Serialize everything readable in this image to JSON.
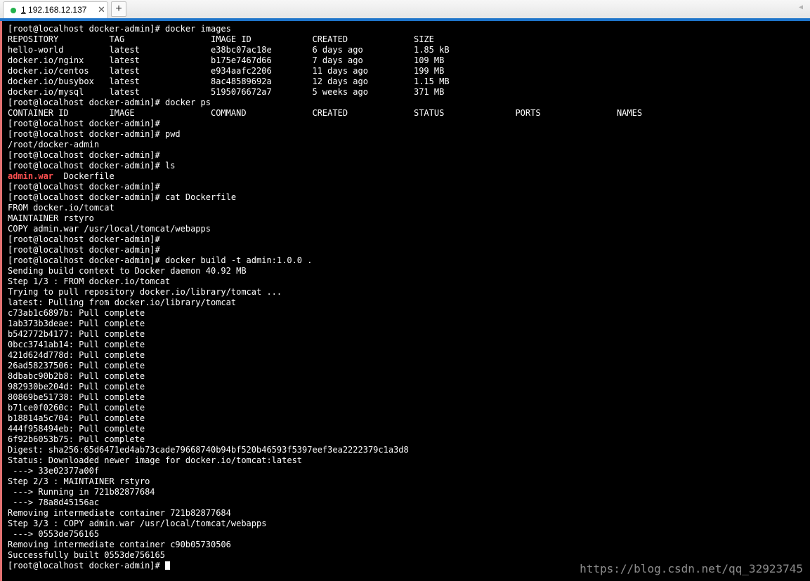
{
  "tab": {
    "number": "1",
    "title": "192.168.12.137",
    "close_glyph": "✕",
    "status_color": "#22b14c"
  },
  "toolbar": {
    "new_tab_glyph": "+",
    "scroll_left_glyph": "◀"
  },
  "terminal": {
    "lines": [
      "[root@localhost docker-admin]# docker images",
      "REPOSITORY          TAG                 IMAGE ID            CREATED             SIZE",
      "hello-world         latest              e38bc07ac18e        6 days ago          1.85 kB",
      "docker.io/nginx     latest              b175e7467d66        7 days ago          109 MB",
      "docker.io/centos    latest              e934aafc2206        11 days ago         199 MB",
      "docker.io/busybox   latest              8ac48589692a        12 days ago         1.15 MB",
      "docker.io/mysql     latest              5195076672a7        5 weeks ago         371 MB",
      "[root@localhost docker-admin]# docker ps",
      "CONTAINER ID        IMAGE               COMMAND             CREATED             STATUS              PORTS               NAMES",
      "[root@localhost docker-admin]#",
      "[root@localhost docker-admin]# pwd",
      "/root/docker-admin",
      "[root@localhost docker-admin]#",
      "[root@localhost docker-admin]# ls",
      "",
      "[root@localhost docker-admin]#",
      "[root@localhost docker-admin]# cat Dockerfile",
      "FROM docker.io/tomcat",
      "MAINTAINER rstyro",
      "COPY admin.war /usr/local/tomcat/webapps",
      "[root@localhost docker-admin]#",
      "[root@localhost docker-admin]#",
      "[root@localhost docker-admin]# docker build -t admin:1.0.0 .",
      "Sending build context to Docker daemon 40.92 MB",
      "Step 1/3 : FROM docker.io/tomcat",
      "Trying to pull repository docker.io/library/tomcat ...",
      "latest: Pulling from docker.io/library/tomcat",
      "c73ab1c6897b: Pull complete",
      "1ab373b3deae: Pull complete",
      "b542772b4177: Pull complete",
      "0bcc3741ab14: Pull complete",
      "421d624d778d: Pull complete",
      "26ad58237506: Pull complete",
      "8dbabc90b2b8: Pull complete",
      "982930be204d: Pull complete",
      "80869be51738: Pull complete",
      "b71ce0f0260c: Pull complete",
      "b18814a5c704: Pull complete",
      "444f958494eb: Pull complete",
      "6f92b6053b75: Pull complete",
      "Digest: sha256:65d6471ed4ab73cade79668740b94bf520b46593f5397eef3ea2222379c1a3d8",
      "Status: Downloaded newer image for docker.io/tomcat:latest",
      " ---> 33e02377a00f",
      "Step 2/3 : MAINTAINER rstyro",
      " ---> Running in 721b82877684",
      " ---> 78a8d45156ac",
      "Removing intermediate container 721b82877684",
      "Step 3/3 : COPY admin.war /usr/local/tomcat/webapps",
      " ---> 0553de756165",
      "Removing intermediate container c90b05730506",
      "Successfully built 0553de756165",
      "[root@localhost docker-admin]# "
    ],
    "ls_output": {
      "war_file": "admin.war",
      "separator": "  ",
      "dockerfile": "Dockerfile"
    },
    "colors": {
      "background": "#000000",
      "foreground": "#ffffff",
      "highlight": "#ff5050",
      "accent": "#1e74c9"
    }
  },
  "watermark": "https://blog.csdn.net/qq_32923745"
}
